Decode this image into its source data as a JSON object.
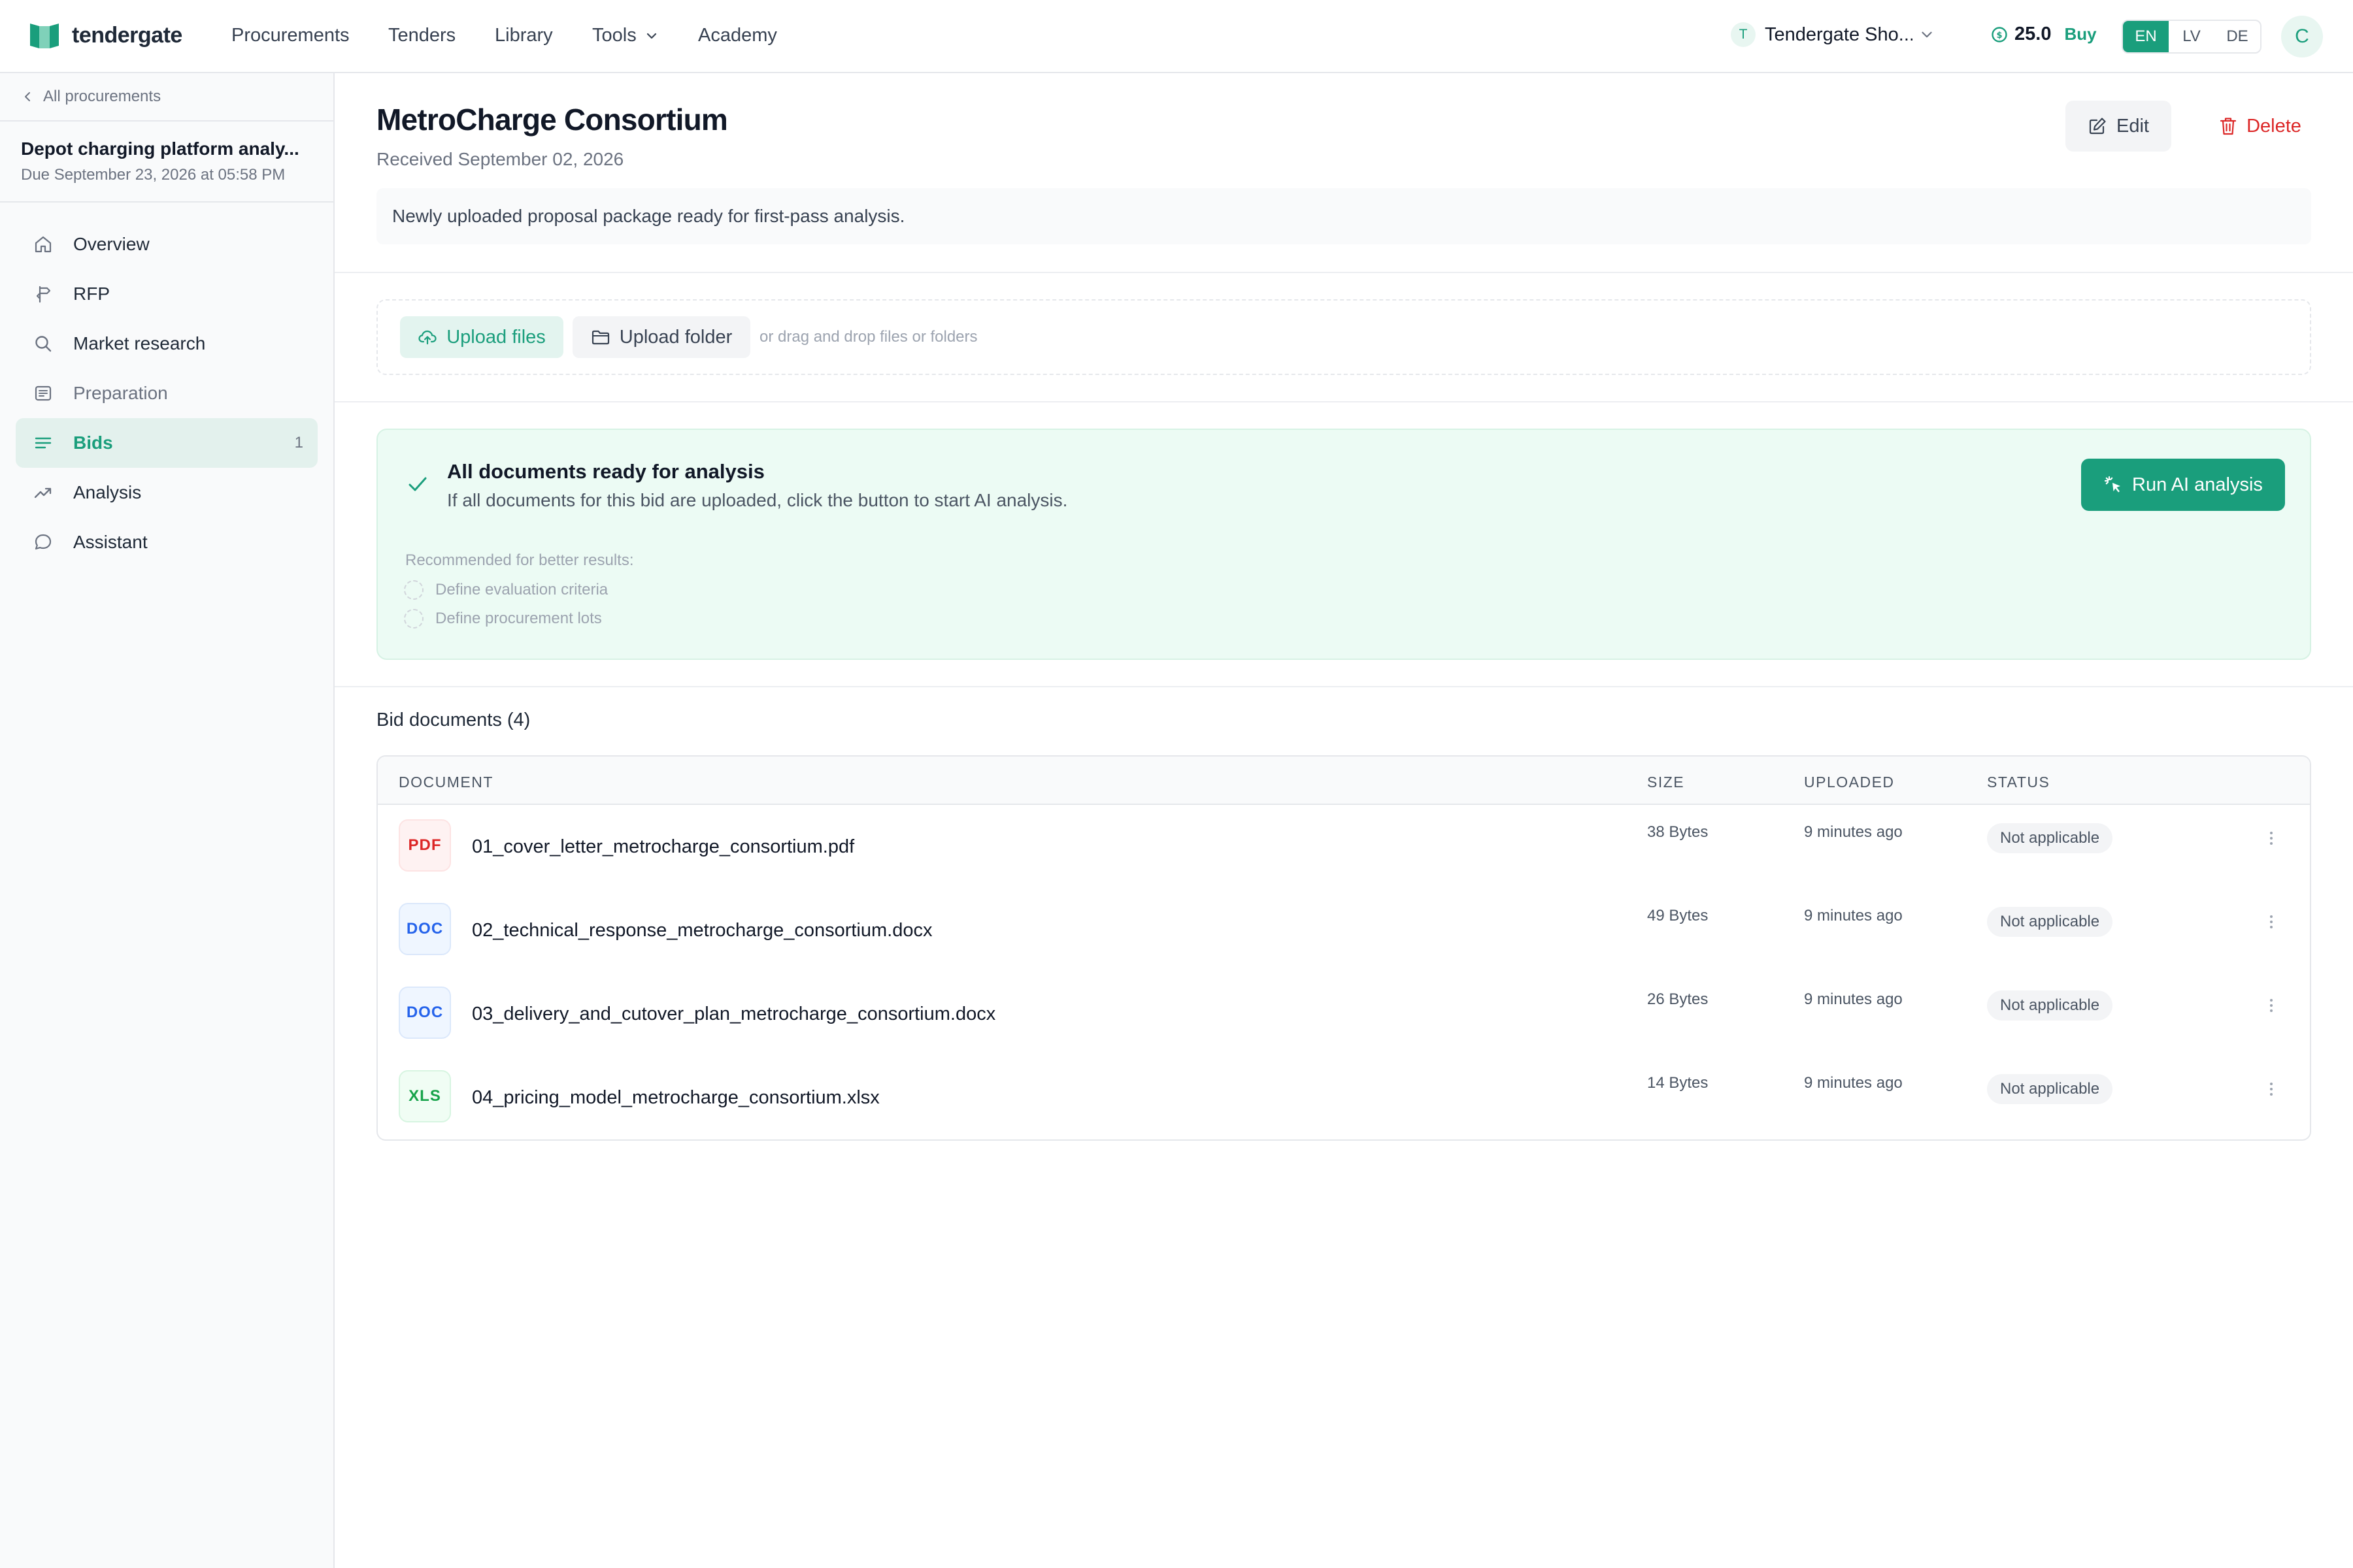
{
  "brand": {
    "name": "tendergate",
    "accent": "#1a9e7c"
  },
  "nav": {
    "procurements": "Procurements",
    "tenders": "Tenders",
    "library": "Library",
    "tools": "Tools",
    "academy": "Academy"
  },
  "org": {
    "initial": "T",
    "name": "Tendergate Sho..."
  },
  "credits": {
    "value": "25.0",
    "buy": "Buy"
  },
  "languages": {
    "en": "EN",
    "lv": "LV",
    "de": "DE",
    "active": "EN"
  },
  "user": {
    "initial": "C"
  },
  "sidebar": {
    "back": "All procurements",
    "procurement_title": "Depot charging platform analy...",
    "procurement_due": "Due September 23, 2026 at 05:58 PM",
    "items": [
      {
        "label": "Overview",
        "icon": "home-icon"
      },
      {
        "label": "RFP",
        "icon": "signpost-icon"
      },
      {
        "label": "Market research",
        "icon": "search-icon"
      },
      {
        "label": "Preparation",
        "icon": "clipboard-icon"
      },
      {
        "label": "Bids",
        "icon": "list-icon",
        "count": "1",
        "active": true
      },
      {
        "label": "Analysis",
        "icon": "trend-up-icon"
      },
      {
        "label": "Assistant",
        "icon": "chat-bubble-icon"
      }
    ]
  },
  "bid": {
    "title": "MetroCharge Consortium",
    "received": "Received September 02, 2026",
    "description": "Newly uploaded proposal package ready for first-pass analysis.",
    "edit": "Edit",
    "delete": "Delete"
  },
  "upload": {
    "files_label": "Upload files",
    "folder_label": "Upload folder",
    "hint": "or drag and drop files or folders"
  },
  "ready": {
    "title": "All documents ready for analysis",
    "subtitle": "If all documents for this bid are uploaded, click the button to start AI analysis.",
    "run_label": "Run AI analysis",
    "recommended_label": "Recommended for better results:",
    "recommended": [
      "Define evaluation criteria",
      "Define procurement lots"
    ]
  },
  "documents": {
    "heading": "Bid documents (4)",
    "columns": {
      "document": "DOCUMENT",
      "size": "SIZE",
      "uploaded": "UPLOADED",
      "status": "STATUS"
    },
    "rows": [
      {
        "type": "PDF",
        "name": "01_cover_letter_metrocharge_consortium.pdf",
        "size": "38 Bytes",
        "uploaded": "9 minutes ago",
        "status": "Not applicable"
      },
      {
        "type": "DOC",
        "name": "02_technical_response_metrocharge_consortium.docx",
        "size": "49 Bytes",
        "uploaded": "9 minutes ago",
        "status": "Not applicable"
      },
      {
        "type": "DOC",
        "name": "03_delivery_and_cutover_plan_metrocharge_consortium.docx",
        "size": "26 Bytes",
        "uploaded": "9 minutes ago",
        "status": "Not applicable"
      },
      {
        "type": "XLS",
        "name": "04_pricing_model_metrocharge_consortium.xlsx",
        "size": "14 Bytes",
        "uploaded": "9 minutes ago",
        "status": "Not applicable"
      }
    ]
  }
}
